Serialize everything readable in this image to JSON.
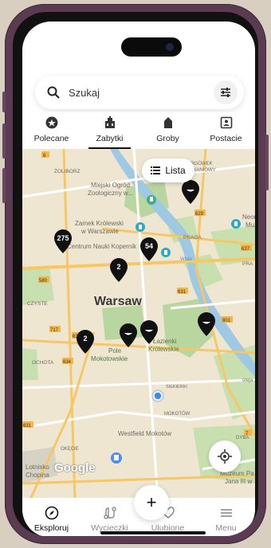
{
  "search": {
    "placeholder": "Szukaj"
  },
  "tabs": [
    {
      "label": "Polecane",
      "icon": "star-badge-icon"
    },
    {
      "label": "Zabytki",
      "icon": "building-icon",
      "active": true
    },
    {
      "label": "Groby",
      "icon": "tombstone-icon"
    },
    {
      "label": "Postacie",
      "icon": "portrait-icon"
    }
  ],
  "map": {
    "lista_label": "Lista",
    "city_label": "Warsaw",
    "labels": {
      "zoliborz": "ŻOLIBORZ",
      "targowek": "TARGÓWEK",
      "mieszkaniowy": "MIESZKANIOWY",
      "zoo1": "Miejski Ogród",
      "zoo2": "Zoologiczny w...",
      "zamek1": "Zamek Królewski",
      "zamek2": "w Warszawie",
      "centrum": "Centrum Nauki Kopernik",
      "praga": "PRAGA",
      "neon1": "Neon",
      "neon2": "Muz",
      "czyste": "CZYSTE",
      "ochota": "OCHOTA",
      "pole1": "Pole",
      "pole2": "Mokotowskie",
      "lazienki1": "Łazienki",
      "lazienki2": "Królewskie",
      "mokotow": "MOKOTÓW",
      "westfield": "Westfield Mokotów",
      "okecie": "OKĘCIE",
      "lotnisko": "Lotnisko",
      "chopina": "Chopina",
      "muzeum1": "Muzeum Pa",
      "muzeum2": "Jana III w",
      "dyba": "DYBA",
      "siekierki": "ŚIEKIERKI",
      "wisla": "Wisła",
      "sleja": "sleja Ż",
      "pra": "PRA",
      "google": "Google"
    },
    "roads": [
      "8",
      "629",
      "637",
      "580",
      "631",
      "801",
      "717",
      "634",
      "634",
      "631",
      "7"
    ],
    "clusters": [
      "275",
      "54",
      "2",
      "2"
    ]
  },
  "nav": [
    {
      "label": "Eksploruj",
      "icon": "compass-icon",
      "active": true
    },
    {
      "label": "Wycieczki",
      "icon": "route-icon"
    },
    {
      "label": "Ulubione",
      "icon": "heart-icon"
    },
    {
      "label": "Menu",
      "icon": "menu-icon"
    }
  ],
  "fab": {
    "icon": "plus-icon",
    "glyph": "+"
  },
  "colors": {
    "map_bg": "#efe6d2",
    "park": "#b9d6a0",
    "water": "#9fc8e3",
    "road": "#f6c766",
    "accent": "#111111"
  }
}
